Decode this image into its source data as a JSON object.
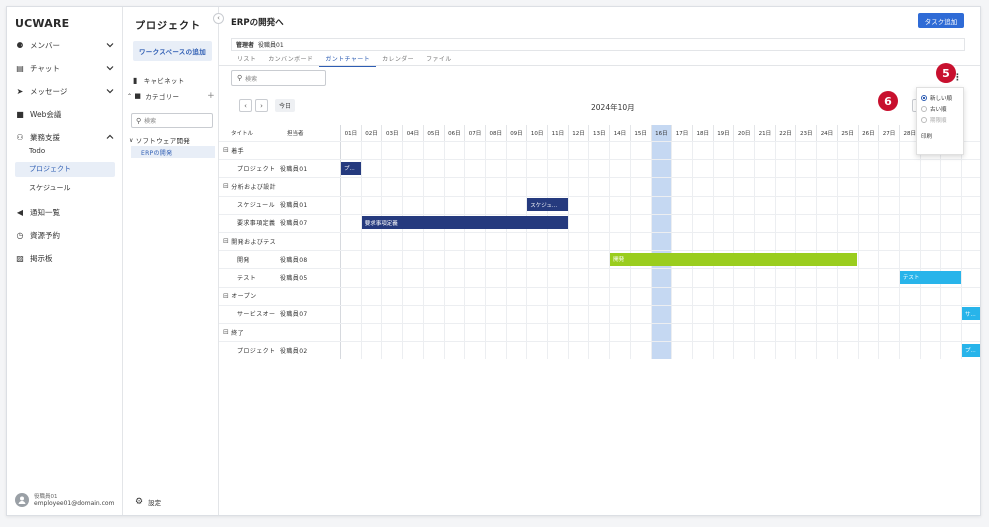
{
  "app": {
    "brand": "UCWARE"
  },
  "sidebar": {
    "items": [
      {
        "label": "メンバー",
        "icon": "members-icon",
        "glyph": "⚈",
        "chevron": "down"
      },
      {
        "label": "チャット",
        "icon": "chat-icon",
        "glyph": "▤",
        "chevron": "down"
      },
      {
        "label": "メッセージ",
        "icon": "message-icon",
        "glyph": "➤",
        "chevron": "down"
      },
      {
        "label": "Web会議",
        "icon": "video-icon",
        "glyph": "■",
        "chevron": ""
      },
      {
        "label": "業務支援",
        "icon": "work-support-icon",
        "glyph": "⚇",
        "chevron": "up"
      }
    ],
    "subitems": [
      {
        "label": "Todo",
        "active": false
      },
      {
        "label": "プロジェクト",
        "active": true
      },
      {
        "label": "スケジュール",
        "active": false
      }
    ],
    "items2": [
      {
        "label": "通知一覧",
        "icon": "bell-icon",
        "glyph": "◀"
      },
      {
        "label": "資源予約",
        "icon": "clock-icon",
        "glyph": "◷"
      },
      {
        "label": "掲示板",
        "icon": "board-icon",
        "glyph": "▨"
      }
    ],
    "user": {
      "name": "役職員01",
      "email": "employee01@domain.com"
    }
  },
  "project_panel": {
    "title": "プロジェクト",
    "workspace_add": "ワークスペースの追加",
    "cabinet": "キャビネット",
    "category": "カテゴリー",
    "category_add": "+",
    "search_placeholder": "検索",
    "tree_group": "ソフトウェア開発",
    "tree_item": "ERPの開発",
    "settings": "設定"
  },
  "main": {
    "title": "ERPの開発へ",
    "add_task": "タスク追加",
    "manager_label": "管理者",
    "manager_value": "役職員01",
    "tabs": [
      {
        "label": "リスト",
        "active": false
      },
      {
        "label": "カンバンボード",
        "active": false
      },
      {
        "label": "ガントチャート",
        "active": true
      },
      {
        "label": "カレンダー",
        "active": false
      },
      {
        "label": "ファイル",
        "active": false
      }
    ],
    "search_placeholder": "検索",
    "today_label": "今日",
    "month_label": "2024年10月",
    "view_toggle": "日",
    "badges": {
      "sort": "5",
      "view": "6"
    },
    "sort_menu": {
      "options": [
        {
          "label": "新しい順",
          "selected": true,
          "disabled": false
        },
        {
          "label": "古い順",
          "selected": false,
          "disabled": false
        },
        {
          "label": "期限順",
          "selected": false,
          "disabled": true
        }
      ],
      "print": "印刷"
    }
  },
  "gantt": {
    "col_title": "タイトル",
    "col_assignee": "担当者",
    "days": [
      "01日",
      "02日",
      "03日",
      "04日",
      "05日",
      "06日",
      "07日",
      "08日",
      "09日",
      "10日",
      "11日",
      "12日",
      "13日",
      "14日",
      "15日",
      "16日",
      "17日",
      "18日",
      "19日",
      "20日",
      "21日",
      "22日",
      "23日",
      "24日",
      "25日",
      "26日",
      "27日",
      "28日",
      "29日",
      "30日"
    ],
    "today_day": 16,
    "rows": [
      {
        "type": "group",
        "title": "着手"
      },
      {
        "type": "task",
        "title": "プロジェクト",
        "assignee": "役職員01",
        "bar": {
          "start": 1,
          "end": 1,
          "label": "プ...",
          "color": "#253a7e"
        }
      },
      {
        "type": "group",
        "title": "分析および設計"
      },
      {
        "type": "task",
        "title": "スケジュール",
        "assignee": "役職員01",
        "bar": {
          "start": 10,
          "end": 11,
          "label": "スケジュ...",
          "color": "#253a7e"
        }
      },
      {
        "type": "task",
        "title": "要求事項定義",
        "assignee": "役職員07",
        "bar": {
          "start": 2,
          "end": 11,
          "label": "要求事項定義",
          "color": "#253a7e"
        }
      },
      {
        "type": "group",
        "title": "開発およびテス"
      },
      {
        "type": "task",
        "title": "開発",
        "assignee": "役職員08",
        "bar": {
          "start": 14,
          "end": 25,
          "label": "開発",
          "color": "#9acd1e"
        }
      },
      {
        "type": "task",
        "title": "テスト",
        "assignee": "役職員05",
        "bar": {
          "start": 28,
          "end": 30,
          "label": "テスト",
          "color": "#28b4ea"
        }
      },
      {
        "type": "group",
        "title": "オープン"
      },
      {
        "type": "task",
        "title": "サービスオー",
        "assignee": "役職員07",
        "bar": {
          "start": 31,
          "end": 31,
          "label": "サ...",
          "color": "#28b4ea"
        }
      },
      {
        "type": "group",
        "title": "終了"
      },
      {
        "type": "task",
        "title": "プロジェクト",
        "assignee": "役職員02",
        "bar": {
          "start": 31,
          "end": 31,
          "label": "プ...",
          "color": "#28b4ea"
        }
      }
    ]
  }
}
